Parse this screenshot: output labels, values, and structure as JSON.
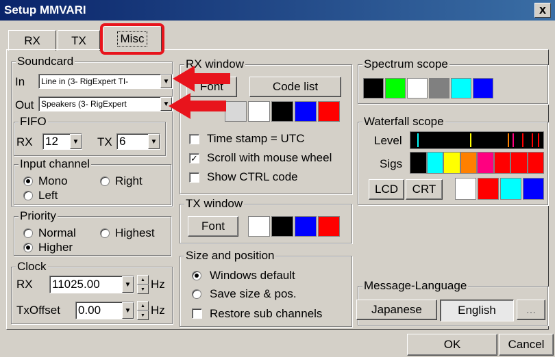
{
  "window": {
    "title": "Setup MMVARI",
    "close_glyph": "x"
  },
  "tabs": [
    {
      "label": "RX"
    },
    {
      "label": "TX"
    },
    {
      "label": "Misc"
    }
  ],
  "soundcard": {
    "title": "Soundcard",
    "in_label": "In",
    "in_value": "Line in (3- RigExpert TI-",
    "out_label": "Out",
    "out_value": "Speakers (3- RigExpert",
    "fifo": {
      "title": "FIFO",
      "rx_label": "RX",
      "rx_value": "12",
      "tx_label": "TX",
      "tx_value": "6"
    }
  },
  "input_channel": {
    "title": "Input channel",
    "mono": "Mono",
    "right": "Right",
    "left": "Left",
    "selected": "Mono"
  },
  "priority": {
    "title": "Priority",
    "normal": "Normal",
    "highest": "Highest",
    "higher": "Higher",
    "selected": "Higher"
  },
  "clock": {
    "title": "Clock",
    "rx_label": "RX",
    "rx_value": "11025.00",
    "rx_unit": "Hz",
    "txoffset_label": "TxOffset",
    "txoffset_value": "0.00",
    "txoffset_unit": "Hz"
  },
  "rx_window": {
    "title": "RX window",
    "font_button": "Font",
    "code_list_button": "Code list",
    "colors": [
      "#d8d8d8",
      "#ffffff",
      "#000000",
      "#0000ff",
      "#ff0000"
    ],
    "time_stamp": {
      "label": "Time stamp = UTC",
      "checked": false
    },
    "scroll_wheel": {
      "label": "Scroll with mouse wheel",
      "checked": true,
      "mark": "✓"
    },
    "show_ctrl": {
      "label": "Show CTRL code",
      "checked": false
    }
  },
  "tx_window": {
    "title": "TX window",
    "font_button": "Font",
    "colors": [
      "#ffffff",
      "#000000",
      "#0000ff",
      "#ff0000"
    ]
  },
  "size_position": {
    "title": "Size and position",
    "windows_default": "Windows default",
    "save_size": "Save size & pos.",
    "restore_sub": "Restore sub channels",
    "selected": "Windows default"
  },
  "spectrum_scope": {
    "title": "Spectrum scope",
    "colors": [
      "#000000",
      "#00ff00",
      "#ffffff",
      "#808080",
      "#00ffff",
      "#0000ff"
    ]
  },
  "waterfall_scope": {
    "title": "Waterfall scope",
    "level_label": "Level",
    "sigs_label": "Sigs",
    "sigs_colors": [
      "#000000",
      "#00ffff",
      "#ffff00",
      "#ff8000",
      "#ff0080",
      "#ff0000",
      "#ff0000",
      "#ff0000"
    ],
    "level_marks": [
      {
        "pos": 0.05,
        "color": "#00ffff"
      },
      {
        "pos": 0.45,
        "color": "#ffff00"
      },
      {
        "pos": 0.73,
        "color": "#ff8000"
      },
      {
        "pos": 0.77,
        "color": "#ff0080"
      },
      {
        "pos": 0.84,
        "color": "#ff0000"
      },
      {
        "pos": 0.91,
        "color": "#ff0000"
      },
      {
        "pos": 0.96,
        "color": "#ff0000"
      }
    ],
    "lcd_button": "LCD",
    "crt_button": "CRT",
    "colors": [
      "#ffffff",
      "#ff0000",
      "#00ffff",
      "#0000ff"
    ]
  },
  "message_language": {
    "title": "Message-Language",
    "japanese": "Japanese",
    "english": "English",
    "more": "..."
  },
  "footer": {
    "ok": "OK",
    "cancel": "Cancel"
  },
  "highlight_color": "#e8141c"
}
